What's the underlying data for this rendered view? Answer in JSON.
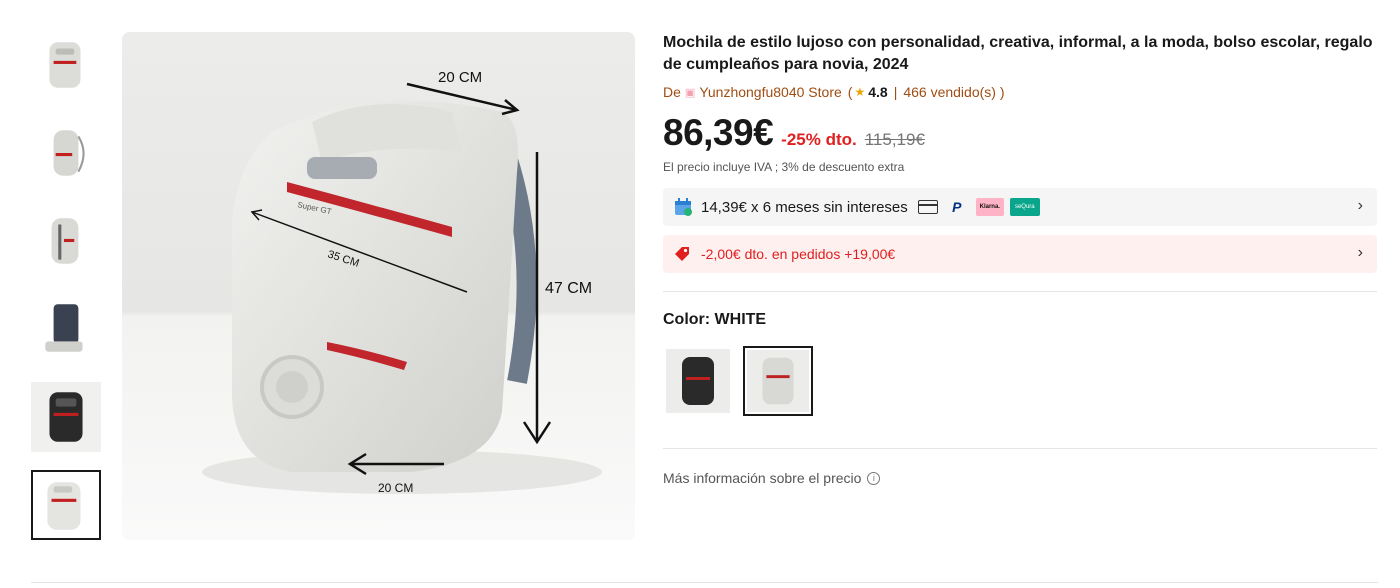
{
  "product": {
    "title": "Mochila de estilo lujoso con personalidad, creativa, informal, a la moda, bolso escolar, regalo de cumpleaños para novia, 2024",
    "store_prefix": "De",
    "store_name": "Yunzhongfu8040 Store",
    "open_paren": "(",
    "rating": "4.8",
    "sold": "466 vendido(s) )",
    "price": "86,39€",
    "discount": "-25% dto.",
    "old_price": "115,19€",
    "tax_note": "El precio incluye IVA ; 3% de descuento extra"
  },
  "installments": {
    "text": "14,39€ x 6 meses sin intereses",
    "klarna": "Klarna.",
    "sequra": "seQura",
    "paypal": "P"
  },
  "coupon": {
    "text": "-2,00€ dto. en pedidos +19,00€"
  },
  "color": {
    "label": "Color: WHITE"
  },
  "more_info": {
    "text": "Más información sobre el precio",
    "icon_glyph": "i"
  },
  "image_annotations": {
    "top_width": "20 CM",
    "depth": "35 CM",
    "height": "47 CM",
    "bottom_width": "20 CM",
    "badge": "Super GT"
  },
  "colors": {
    "accent_red": "#e02020",
    "store_brown": "#a04d12",
    "star": "#e9a700"
  },
  "thumbnails": [
    "backpack-front",
    "backpack-side",
    "backpack-side-2",
    "backpack-open",
    "backpack-black",
    "backpack-white-measured"
  ],
  "swatches": [
    "black",
    "white"
  ]
}
